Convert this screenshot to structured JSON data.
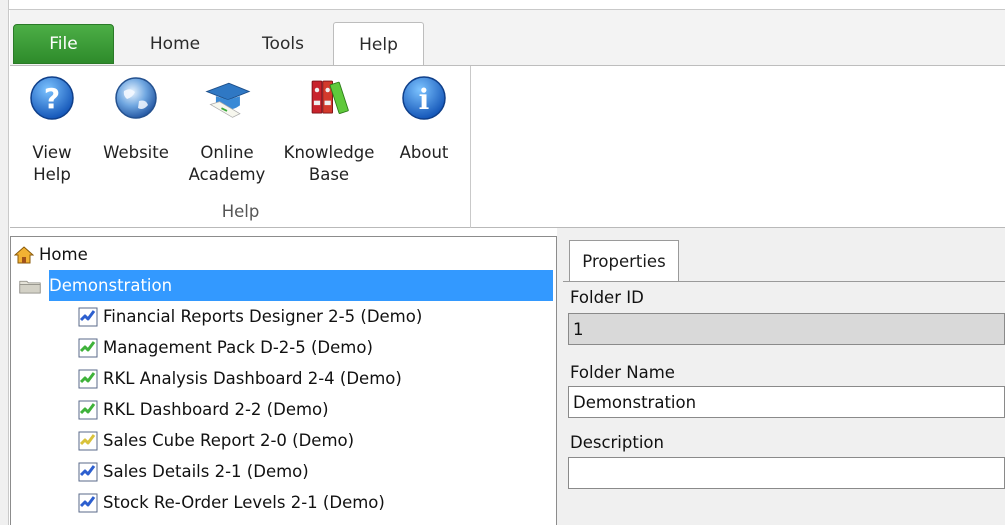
{
  "ribbon": {
    "tabs": [
      {
        "label": "File"
      },
      {
        "label": "Home"
      },
      {
        "label": "Tools"
      },
      {
        "label": "Help"
      }
    ],
    "active_tab": "Help",
    "buttons": [
      {
        "label": "View\nHelp",
        "icon": "help-question-icon"
      },
      {
        "label": "Website",
        "icon": "globe-icon"
      },
      {
        "label": "Online\nAcademy",
        "icon": "graduation-cap-icon"
      },
      {
        "label": "Knowledge\nBase",
        "icon": "binders-icon"
      },
      {
        "label": "About",
        "icon": "info-icon"
      }
    ],
    "group_label": "Help"
  },
  "tree": {
    "root": {
      "label": "Home",
      "icon": "home-icon"
    },
    "folder": {
      "label": "Demonstration",
      "icon": "folder-icon",
      "selected": true
    },
    "items": [
      {
        "label": "Financial Reports Designer 2-5 (Demo)",
        "icon": "report-blue-icon"
      },
      {
        "label": "Management Pack D-2-5 (Demo)",
        "icon": "report-green-icon"
      },
      {
        "label": "RKL Analysis Dashboard 2-4 (Demo)",
        "icon": "report-green-icon"
      },
      {
        "label": "RKL Dashboard 2-2 (Demo)",
        "icon": "report-green-icon"
      },
      {
        "label": "Sales Cube Report 2-0 (Demo)",
        "icon": "report-yellow-icon"
      },
      {
        "label": "Sales Details 2-1 (Demo)",
        "icon": "report-blue-icon"
      },
      {
        "label": "Stock Re-Order Levels 2-1 (Demo)",
        "icon": "report-blue-icon"
      }
    ]
  },
  "properties": {
    "tab_label": "Properties",
    "folder_id_label": "Folder ID",
    "folder_id_value": "1",
    "folder_name_label": "Folder Name",
    "folder_name_value": "Demonstration",
    "description_label": "Description",
    "description_value": ""
  },
  "colors": {
    "file_tab": "#3a9c36",
    "selection": "#3399ff",
    "readonly_field": "#d9d9d9"
  }
}
